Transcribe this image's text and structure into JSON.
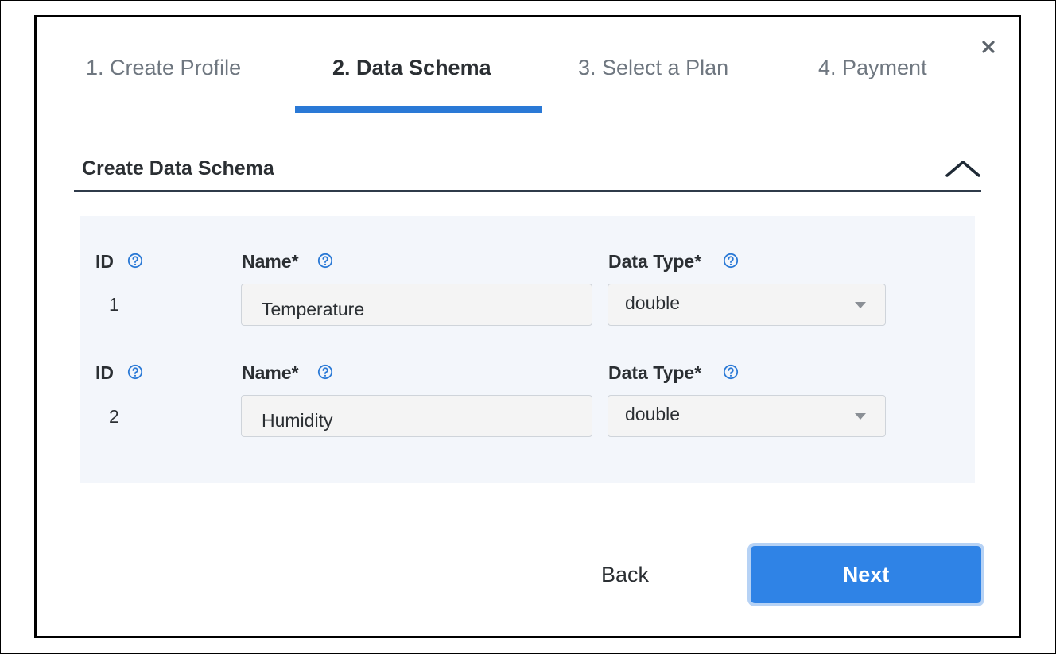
{
  "tabs": [
    {
      "label": "1. Create Profile",
      "active": false
    },
    {
      "label": "2. Data Schema",
      "active": true
    },
    {
      "label": "3. Select a Plan",
      "active": false
    },
    {
      "label": "4. Payment",
      "active": false
    }
  ],
  "section": {
    "title": "Create Data Schema",
    "collapse_icon": "chevron-up-icon"
  },
  "labels": {
    "id": "ID",
    "name": "Name*",
    "data_type": "Data Type*"
  },
  "rows": [
    {
      "id": "1",
      "name": "Temperature",
      "data_type": "double"
    },
    {
      "id": "2",
      "name": "Humidity",
      "data_type": "double"
    }
  ],
  "buttons": {
    "back": "Back",
    "next": "Next"
  },
  "icons": {
    "close": "close-icon",
    "help": "help-circle-icon",
    "dropdown": "caret-down-icon"
  },
  "colors": {
    "accent": "#2a79d6",
    "primary_button": "#2f83e6",
    "panel_background": "#f3f6fb"
  }
}
